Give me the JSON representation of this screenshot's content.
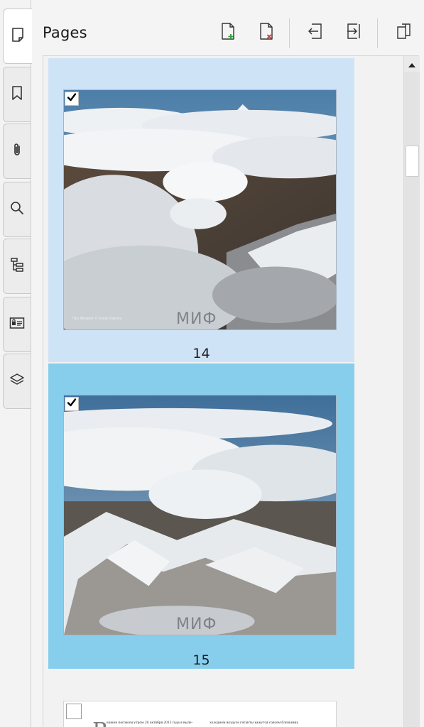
{
  "panel": {
    "title": "Pages"
  },
  "side_tabs": [
    {
      "icon": "page-icon",
      "active": true
    },
    {
      "icon": "bookmark-icon"
    },
    {
      "icon": "paperclip-icon"
    },
    {
      "icon": "search-icon"
    },
    {
      "icon": "structure-tree-icon"
    },
    {
      "icon": "signature-card-icon"
    },
    {
      "icon": "layers-icon"
    }
  ],
  "toolbar": [
    {
      "icon": "insert-page-icon"
    },
    {
      "icon": "delete-page-icon"
    },
    {
      "icon": "extract-page-icon"
    },
    {
      "icon": "import-page-icon"
    },
    {
      "icon": "replace-page-icon"
    }
  ],
  "pages": [
    {
      "number": "14",
      "checked": true,
      "credit": "Про Айсминг © Юлия Коротко",
      "watermark": "МИФ"
    },
    {
      "number": "15",
      "checked": true,
      "watermark": "МИФ"
    },
    {
      "checked": false,
      "dropcap": "В",
      "text_left": "ешние погожим утром 26 октября 2013 года я выле-",
      "text_right": "холодном воздухе гиганты кажутся совсем близкими;"
    }
  ],
  "colors": {
    "selected_light": "#cfe3f7",
    "selected_strong": "#87ceed",
    "accent_add": "#2e9b3b",
    "accent_delete": "#d32f2f"
  }
}
